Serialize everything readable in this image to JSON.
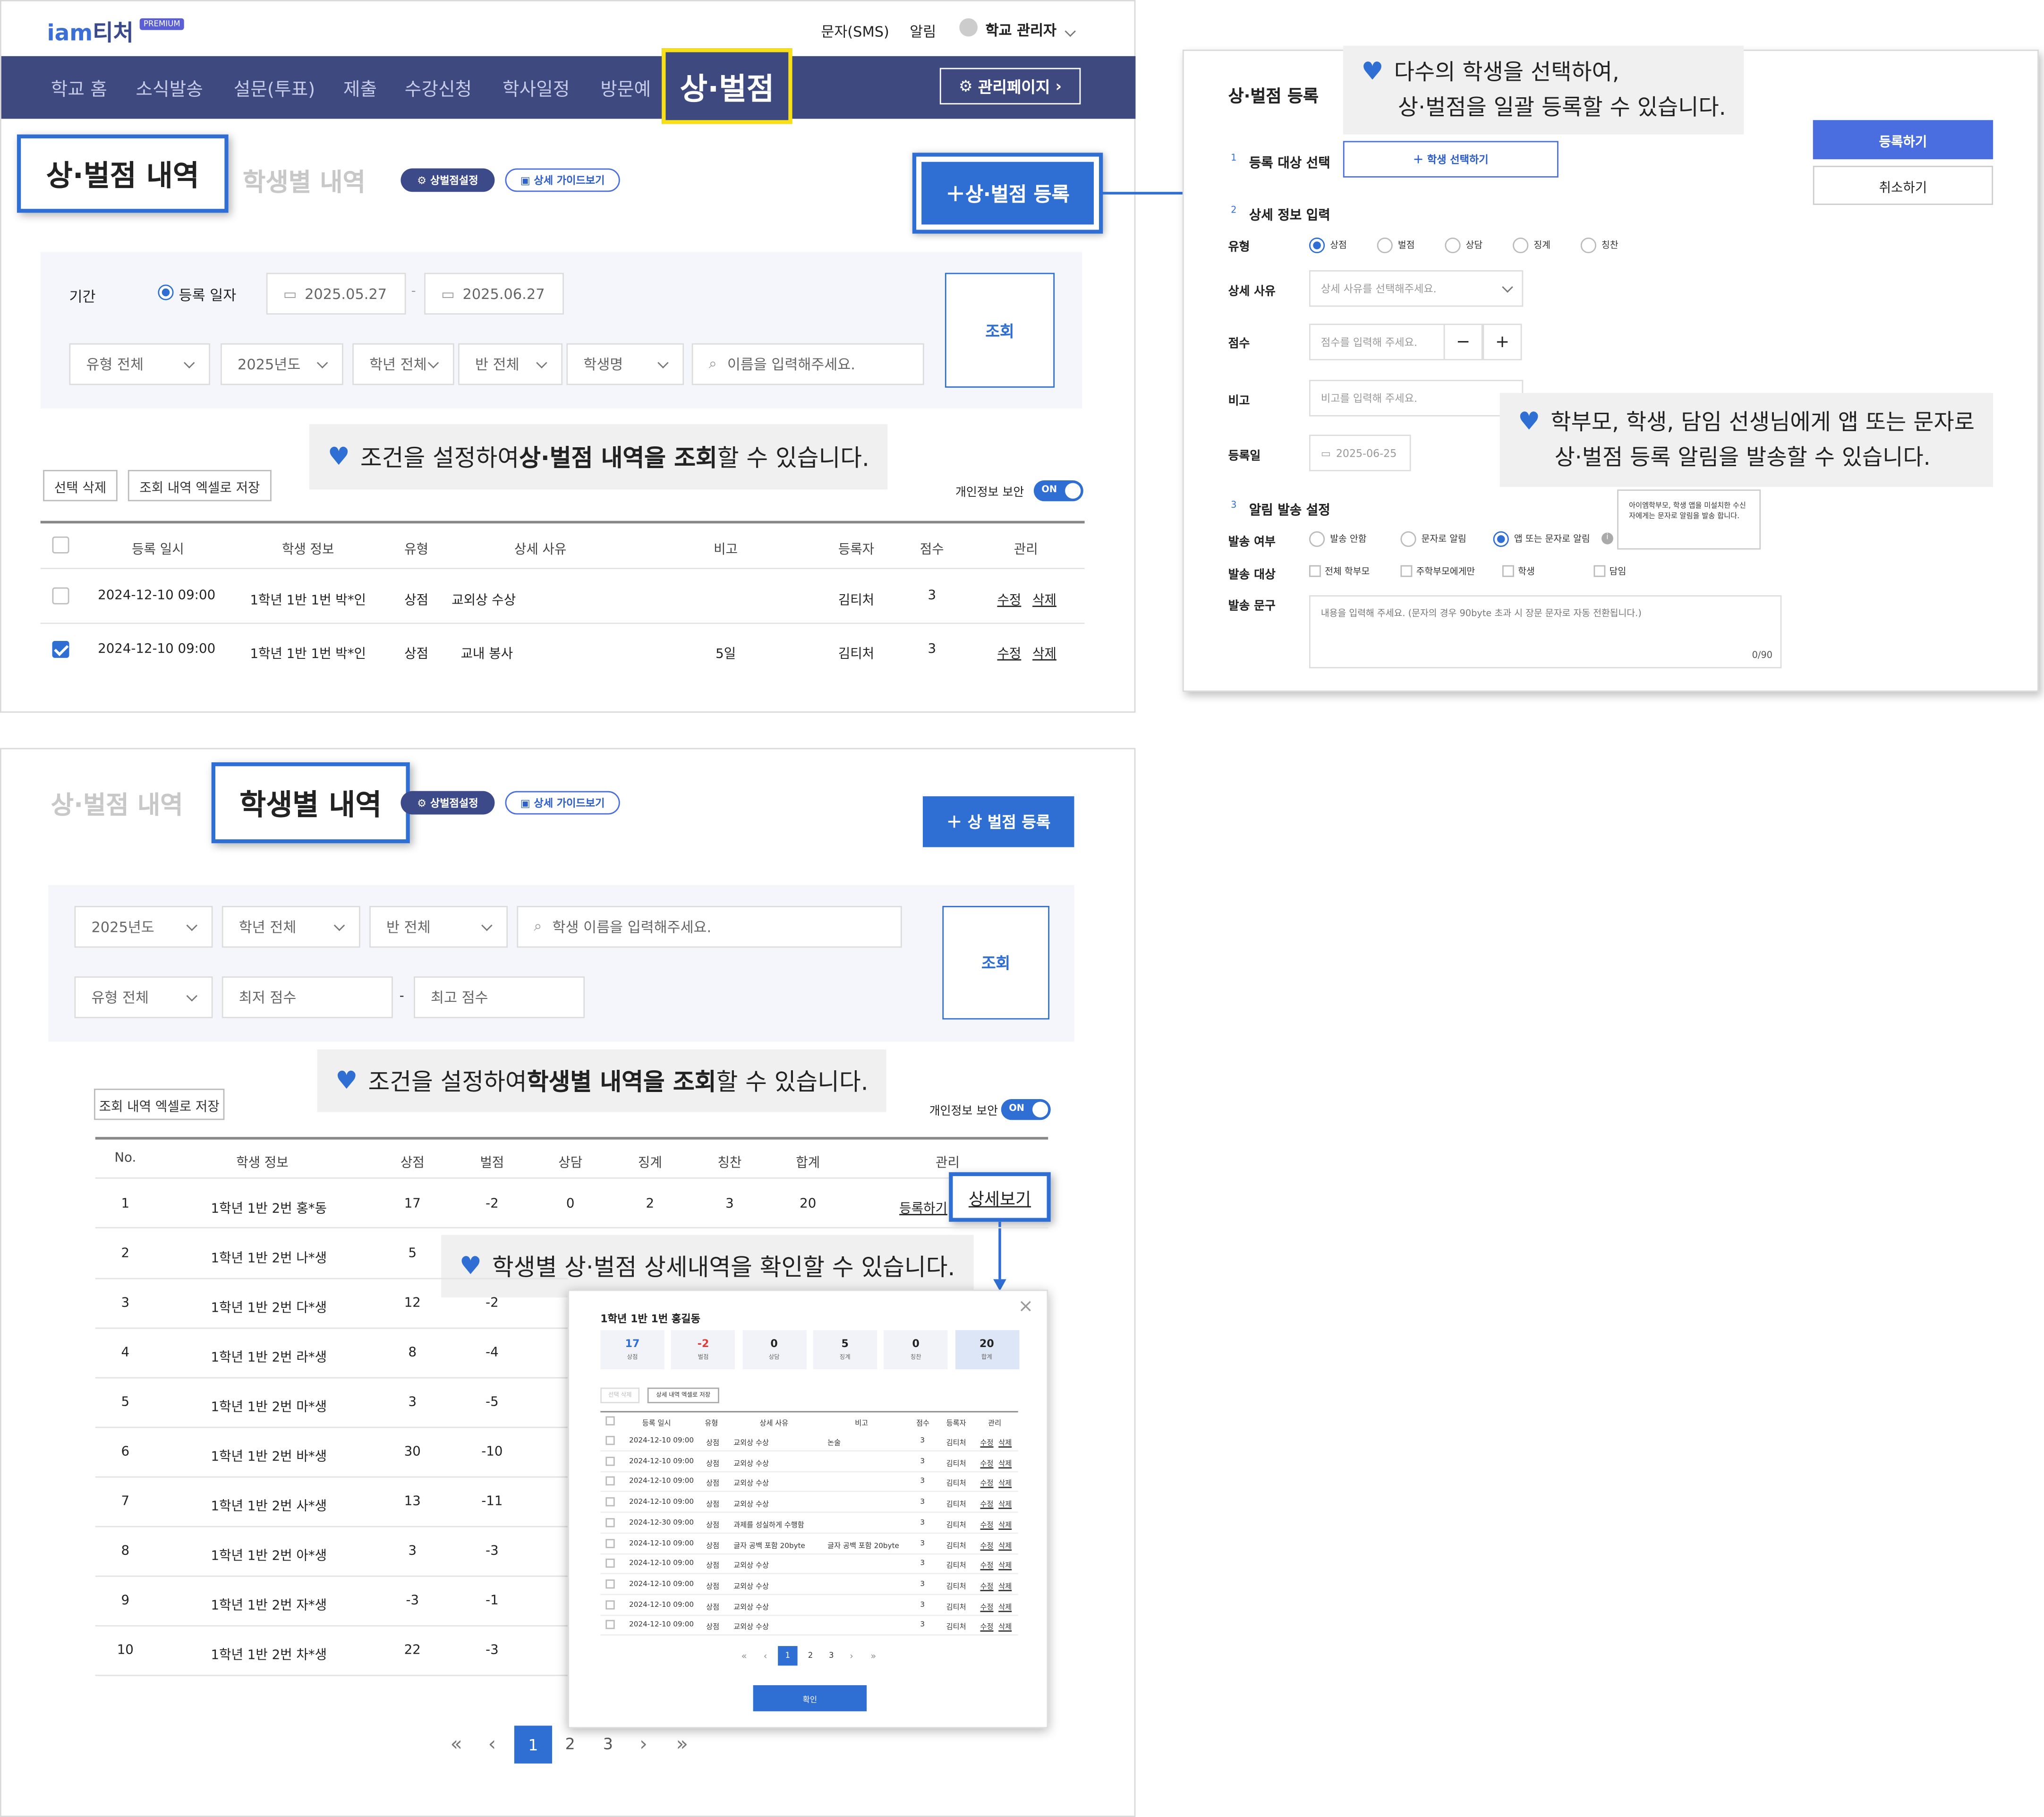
{
  "header": {
    "logo_iam": "iam",
    "logo_teacher": "티처",
    "logo_badge": "PREMIUM",
    "sms": "문자(SMS)",
    "alarm": "알림",
    "user": "학교 관리자"
  },
  "nav": {
    "items": [
      "학교 홈",
      "소식발송",
      "설문(투표)",
      "제출",
      "수강신청",
      "학사일정",
      "방문예"
    ],
    "active": "상·벌점",
    "admin": "관리페이지"
  },
  "top": {
    "tab_active": "상·벌점 내역",
    "tab_inactive": "학생별 내역",
    "settings_btn": "상벌점설정",
    "guide_btn": "상세 가이드보기",
    "register_btn": "상·벌점 등록",
    "filter": {
      "period": "기간",
      "reg_date": "등록 일자",
      "date_from": "2025.05.27",
      "date_to": "2025.06.27",
      "sep": "-",
      "type": "유형 전체",
      "year": "2025년도",
      "grade": "학년 전체",
      "class": "반 전체",
      "student": "학생명",
      "name_ph": "이름을 입력해주세요.",
      "search": "조회"
    },
    "callout_pre": "조건을 설정하여 ",
    "callout_bold": "상·벌점 내역을 조회",
    "callout_post": "할 수 있습니다.",
    "del_btn": "선택 삭제",
    "excel_btn": "조회 내역 엑셀로 저장",
    "privacy": "개인정보 보안",
    "toggle": "ON",
    "headers": [
      "등록 일시",
      "학생 정보",
      "유형",
      "상세 사유",
      "비고",
      "등록자",
      "점수",
      "관리"
    ],
    "rows": [
      {
        "date": "2024-12-10 09:00",
        "student": "1학년 1반 1번 박*인",
        "type": "상점",
        "reason": "교외상 수상",
        "note": "",
        "by": "김티처",
        "score": "3",
        "edit": "수정",
        "del": "삭제",
        "checked": false
      },
      {
        "date": "2024-12-10 09:00",
        "student": "1학년 1반 1번 박*인",
        "type": "상점",
        "reason": "교내 봉사",
        "note": "5일",
        "by": "김티처",
        "score": "3",
        "edit": "수정",
        "del": "삭제",
        "checked": true
      }
    ]
  },
  "reg": {
    "title": "상·벌점 등록",
    "callout1_l1": "다수의 학생을 선택하여,",
    "callout1_l2": "상·벌점을 일괄 등록할 수 있습니다.",
    "submit": "등록하기",
    "cancel": "취소하기",
    "step1_no": "1",
    "step1": "등록 대상 선택",
    "select_student": "학생 선택하기",
    "step2_no": "2",
    "step2": "상세 정보 입력",
    "type_label": "유형",
    "types": [
      "상점",
      "벌점",
      "상담",
      "징계",
      "칭찬"
    ],
    "reason_label": "상세 사유",
    "reason_ph": "상세 사유를 선택해주세요.",
    "score_label": "점수",
    "score_ph": "점수를 입력해 주세요.",
    "minus": "−",
    "plus": "+",
    "note_label": "비고",
    "note_ph": "비고를 입력해 주세요.",
    "date_label": "등록일",
    "date_val": "2025-06-25",
    "callout2_l1": "학부모, 학생, 담임 선생님에게 앱 또는 문자로",
    "callout2_l2": "상·벌점 등록 알림을 발송할 수 있습니다.",
    "step3_no": "3",
    "step3": "알림 발송 설정",
    "send_label": "발송 여부",
    "send_opts": [
      "발송 안함",
      "문자로 알림",
      "앱 또는 문자로 알림"
    ],
    "tooltip": "아이엠학부모, 학생 앱을 미설치한 수신자에게는 문자로 알림을 발송 합니다.",
    "target_label": "발송 대상",
    "targets": [
      "전체 학부모",
      "주학부모에게만",
      "학생",
      "담임"
    ],
    "msg_label": "발송 문구",
    "msg_ph": "내용을 입력해 주세요. (문자의 경우 90byte 초과 시 장문 문자로 자동 전환됩니다.)",
    "msg_count": "0/90"
  },
  "bottom": {
    "tab_inactive": "상·벌점 내역",
    "tab_active": "학생별 내역",
    "settings_btn": "상벌점설정",
    "guide_btn": "상세 가이드보기",
    "register_btn": "상 벌점 등록",
    "filter": {
      "year": "2025년도",
      "grade": "학년 전체",
      "class": "반 전체",
      "name_ph": "학생 이름을 입력해주세요.",
      "type": "유형 전체",
      "min": "최저 점수",
      "sep": "-",
      "max": "최고 점수",
      "search": "조회"
    },
    "callout_pre": "조건을 설정하여 ",
    "callout_bold": "학생별 내역을 조회",
    "callout_post": "할 수 있습니다.",
    "excel_btn": "조회 내역 엑셀로 저장",
    "privacy": "개인정보 보안",
    "toggle": "ON",
    "headers": [
      "No.",
      "학생 정보",
      "상점",
      "벌점",
      "상담",
      "징계",
      "칭찬",
      "합계",
      "관리"
    ],
    "row1": {
      "no": "1",
      "student": "1학년 1반 2번 홍*동",
      "s1": "17",
      "s2": "-2",
      "s3": "0",
      "s4": "2",
      "s5": "3",
      "sum": "20",
      "reg": "등록하기"
    },
    "detail_btn": "상세보기",
    "callout2": "학생별 상·벌점 상세내역을 확인할 수 있습니다.",
    "rows": [
      {
        "no": "2",
        "student": "1학년 1반 2번 나*생",
        "a": "5",
        "b": ""
      },
      {
        "no": "3",
        "student": "1학년 1반 2번 다*생",
        "a": "12",
        "b": "-2"
      },
      {
        "no": "4",
        "student": "1학년 1반 2번 라*생",
        "a": "8",
        "b": "-4"
      },
      {
        "no": "5",
        "student": "1학년 1반 2번 마*생",
        "a": "3",
        "b": "-5"
      },
      {
        "no": "6",
        "student": "1학년 1반 2번 바*생",
        "a": "30",
        "b": "-10"
      },
      {
        "no": "7",
        "student": "1학년 1반 2번 사*생",
        "a": "13",
        "b": "-11"
      },
      {
        "no": "8",
        "student": "1학년 1반 2번 아*생",
        "a": "3",
        "b": "-3"
      },
      {
        "no": "9",
        "student": "1학년 1반 2번 자*생",
        "a": "-3",
        "b": "-1"
      },
      {
        "no": "10",
        "student": "1학년 1반 2번 차*생",
        "a": "22",
        "b": "-3"
      }
    ],
    "pager": {
      "first": "«",
      "prev": "‹",
      "pages": [
        "1",
        "2",
        "3"
      ],
      "next": "›",
      "last": "»"
    }
  },
  "modal": {
    "title": "1학년 1반 1번 홍길동",
    "close": "×",
    "stats": [
      {
        "v": "17",
        "l": "상점"
      },
      {
        "v": "-2",
        "l": "벌점"
      },
      {
        "v": "0",
        "l": "상담"
      },
      {
        "v": "5",
        "l": "징계"
      },
      {
        "v": "0",
        "l": "칭찬"
      },
      {
        "v": "20",
        "l": "합계"
      }
    ],
    "del_btn": "선택 삭제",
    "excel_btn": "상세 내역 엑셀로 저장",
    "headers": [
      "등록 일시",
      "유형",
      "상세 사유",
      "비고",
      "점수",
      "등록자",
      "관리"
    ],
    "rows": [
      {
        "date": "2024-12-10 09:00",
        "type": "상점",
        "reason": "교외상 수상",
        "note": "논술",
        "score": "3",
        "by": "김티처"
      },
      {
        "date": "2024-12-10 09:00",
        "type": "상점",
        "reason": "교외상 수상",
        "note": "",
        "score": "3",
        "by": "김티처"
      },
      {
        "date": "2024-12-10 09:00",
        "type": "상점",
        "reason": "교외상 수상",
        "note": "",
        "score": "3",
        "by": "김티처"
      },
      {
        "date": "2024-12-10 09:00",
        "type": "상점",
        "reason": "교외상 수상",
        "note": "",
        "score": "3",
        "by": "김티처"
      },
      {
        "date": "2024-12-30 09:00",
        "type": "상점",
        "reason": "과제를 성실하게 수행함",
        "note": "",
        "score": "3",
        "by": "김티처"
      },
      {
        "date": "2024-12-10 09:00",
        "type": "상점",
        "reason": "글자 공백 포함 20byte",
        "note": "글자 공백 포함 20byte",
        "score": "3",
        "by": "김티처"
      },
      {
        "date": "2024-12-10 09:00",
        "type": "상점",
        "reason": "교외상 수상",
        "note": "",
        "score": "3",
        "by": "김티처"
      },
      {
        "date": "2024-12-10 09:00",
        "type": "상점",
        "reason": "교외상 수상",
        "note": "",
        "score": "3",
        "by": "김티처"
      },
      {
        "date": "2024-12-10 09:00",
        "type": "상점",
        "reason": "교외상 수상",
        "note": "",
        "score": "3",
        "by": "김티처"
      },
      {
        "date": "2024-12-10 09:00",
        "type": "상점",
        "reason": "교외상 수상",
        "note": "",
        "score": "3",
        "by": "김티처"
      }
    ],
    "edit": "수정",
    "del": "삭제",
    "pager": {
      "first": "«",
      "prev": "‹",
      "pages": [
        "1",
        "2",
        "3"
      ],
      "next": "›",
      "last": "»"
    },
    "confirm": "확인"
  },
  "colors": {
    "navy": "#3e4980",
    "blue": "#2f6fd4",
    "yellow": "#f7e017",
    "accent": "#4a6ee0"
  }
}
